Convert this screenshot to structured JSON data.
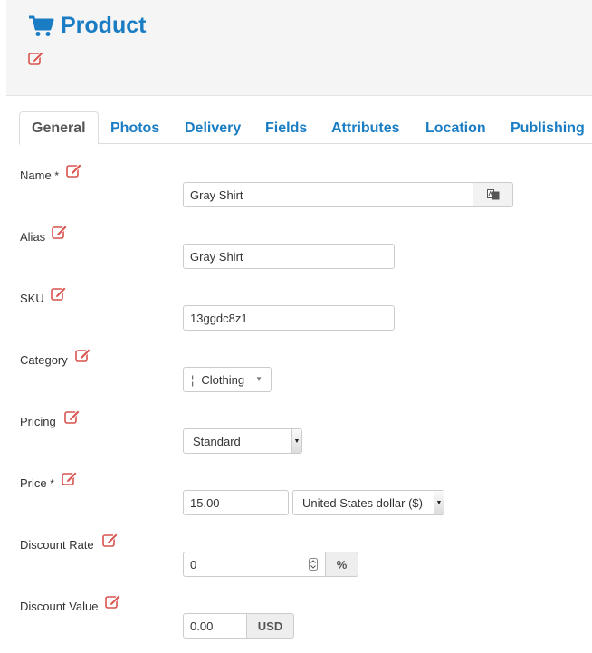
{
  "header": {
    "title": "Product",
    "icon": "shopping-cart-icon",
    "accent_color": "#1a7dc4"
  },
  "tabs": [
    {
      "label": "General",
      "active": true
    },
    {
      "label": "Photos"
    },
    {
      "label": "Delivery"
    },
    {
      "label": "Fields"
    },
    {
      "label": "Attributes"
    },
    {
      "label": "Location"
    },
    {
      "label": "Publishing"
    }
  ],
  "form": {
    "name": {
      "label": "Name",
      "required_mark": "*",
      "value": "Gray Shirt"
    },
    "alias": {
      "label": "Alias",
      "value": "Gray Shirt"
    },
    "sku": {
      "label": "SKU",
      "value": "13ggdc8z1"
    },
    "category": {
      "label": "Category",
      "prefix": "¦",
      "value": "Clothing"
    },
    "pricing": {
      "label": "Pricing",
      "value": "Standard"
    },
    "price": {
      "label": "Price",
      "required_mark": "*",
      "value": "15.00",
      "currency": "United States dollar ($)"
    },
    "discount_rate": {
      "label": "Discount Rate",
      "value": "0",
      "unit": "%"
    },
    "discount_value": {
      "label": "Discount Value",
      "value": "0.00",
      "unit": "USD"
    }
  }
}
